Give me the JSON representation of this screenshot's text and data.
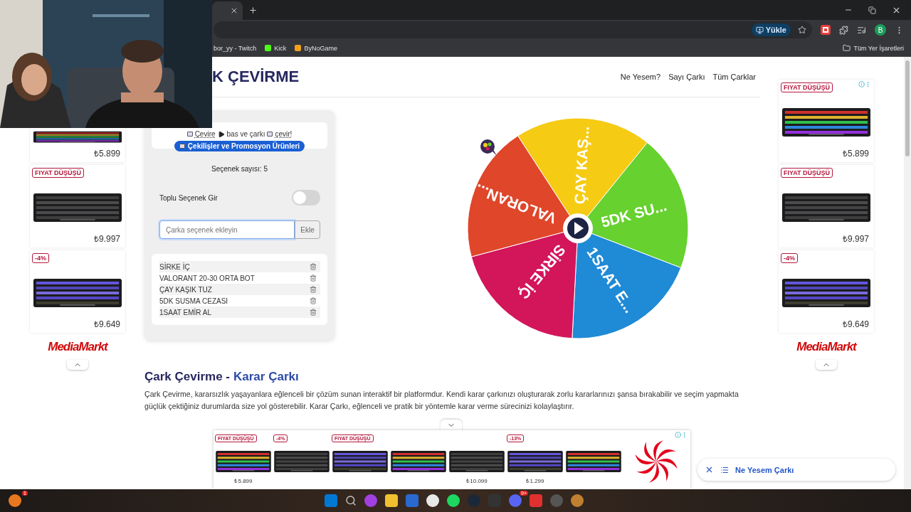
{
  "browser": {
    "install_button": "Yükle",
    "profile": "B",
    "bookmarks": [
      {
        "label": "bor_yy - Twitch",
        "kind": "plain"
      },
      {
        "label": "Kick",
        "kind": "kick"
      },
      {
        "label": "ByNoGame",
        "kind": "bynogame"
      }
    ],
    "all_bookmarks": "Tüm Yer İşaretleri"
  },
  "header": {
    "title": "K ÇEVİRME",
    "nav": [
      "Ne Yesem?",
      "Sayı Çarkı",
      "Tüm Çarklar"
    ]
  },
  "panel": {
    "instruction": [
      "Çevire",
      "bas ve çarkı",
      "çevir!"
    ],
    "promo_button": "Çekilişler ve Promosyon Ürünleri",
    "count": "Seçenek sayısı: 5",
    "bulk_input": {
      "label": "Toplu Seçenek Gir",
      "on": false
    },
    "input": {
      "placeholder": "Çarka seçenek ekleyin",
      "focused": true,
      "button": "Ekle"
    },
    "options": [
      "SİRKE İÇ",
      "VALORANT 20-30 ORTA BOT",
      "ÇAY KAŞIK TUZ",
      "5DK SUSMA CEZASI",
      "1SAAT EMİR AL"
    ]
  },
  "wheel": {
    "segments": [
      {
        "label": "ÇAY KAŞ...",
        "color": "#f5cb14"
      },
      {
        "label": "5DK SU...",
        "color": "#66d12f"
      },
      {
        "label": "1SAAT E...",
        "color": "#1f8ad6"
      },
      {
        "label": "SİRKE İÇ",
        "color": "#d3155a"
      },
      {
        "label": "VALORAN...",
        "color": "#e0462a"
      }
    ]
  },
  "article": {
    "heading": "Çark Çevirme -",
    "heading_accent": "Karar Çarkı",
    "text": "Çark Çevirme, kararsızlık yaşayanlara eğlenceli bir çözüm sunan interaktif bir platformdur. Kendi karar çarkınızı oluşturarak zorlu kararlarınızı şansa bırakabilir ve seçim yapmakta güçlük çektiğiniz durumlarda size yol gösterebilir. Karar Çarkı, eğlenceli ve pratik bir yöntemle karar verme sürecinizi kolaylaştırır."
  },
  "left_ads": {
    "items": [
      {
        "price": "₺5.899"
      },
      {
        "badge": "FIYAT DÜŞÜŞÜ",
        "price": "₺9.997"
      },
      {
        "badge": "-4%",
        "price": "₺9.649"
      }
    ],
    "brand": "MediaMarkt"
  },
  "right_ads": {
    "items": [
      {
        "badge": "FIYAT DÜŞÜŞÜ",
        "price": "₺5.899"
      },
      {
        "badge": "FIYAT DÜŞÜŞÜ",
        "price": "₺9.997"
      },
      {
        "badge": "-4%",
        "price": "₺9.649"
      }
    ],
    "brand": "MediaMarkt"
  },
  "bottom_ad": {
    "items": [
      {
        "kind": "picture",
        "badge": "FIYAT DÜŞÜŞÜ",
        "price": "₺5.899"
      },
      {
        "kind": "picture",
        "badge": "-4%"
      },
      {
        "kind": "picture",
        "badge": "FIYAT DÜŞÜŞÜ"
      },
      {
        "kind": "picture"
      },
      {
        "kind": "picture",
        "price": "₺10.099"
      },
      {
        "kind": "picture",
        "badge": "-13%",
        "price": "₺1.299"
      },
      {
        "kind": "picture"
      }
    ]
  },
  "floating_link": "Ne Yesem Çarkı",
  "taskbar": {
    "notification_count": "1",
    "discord_count": "9+"
  }
}
